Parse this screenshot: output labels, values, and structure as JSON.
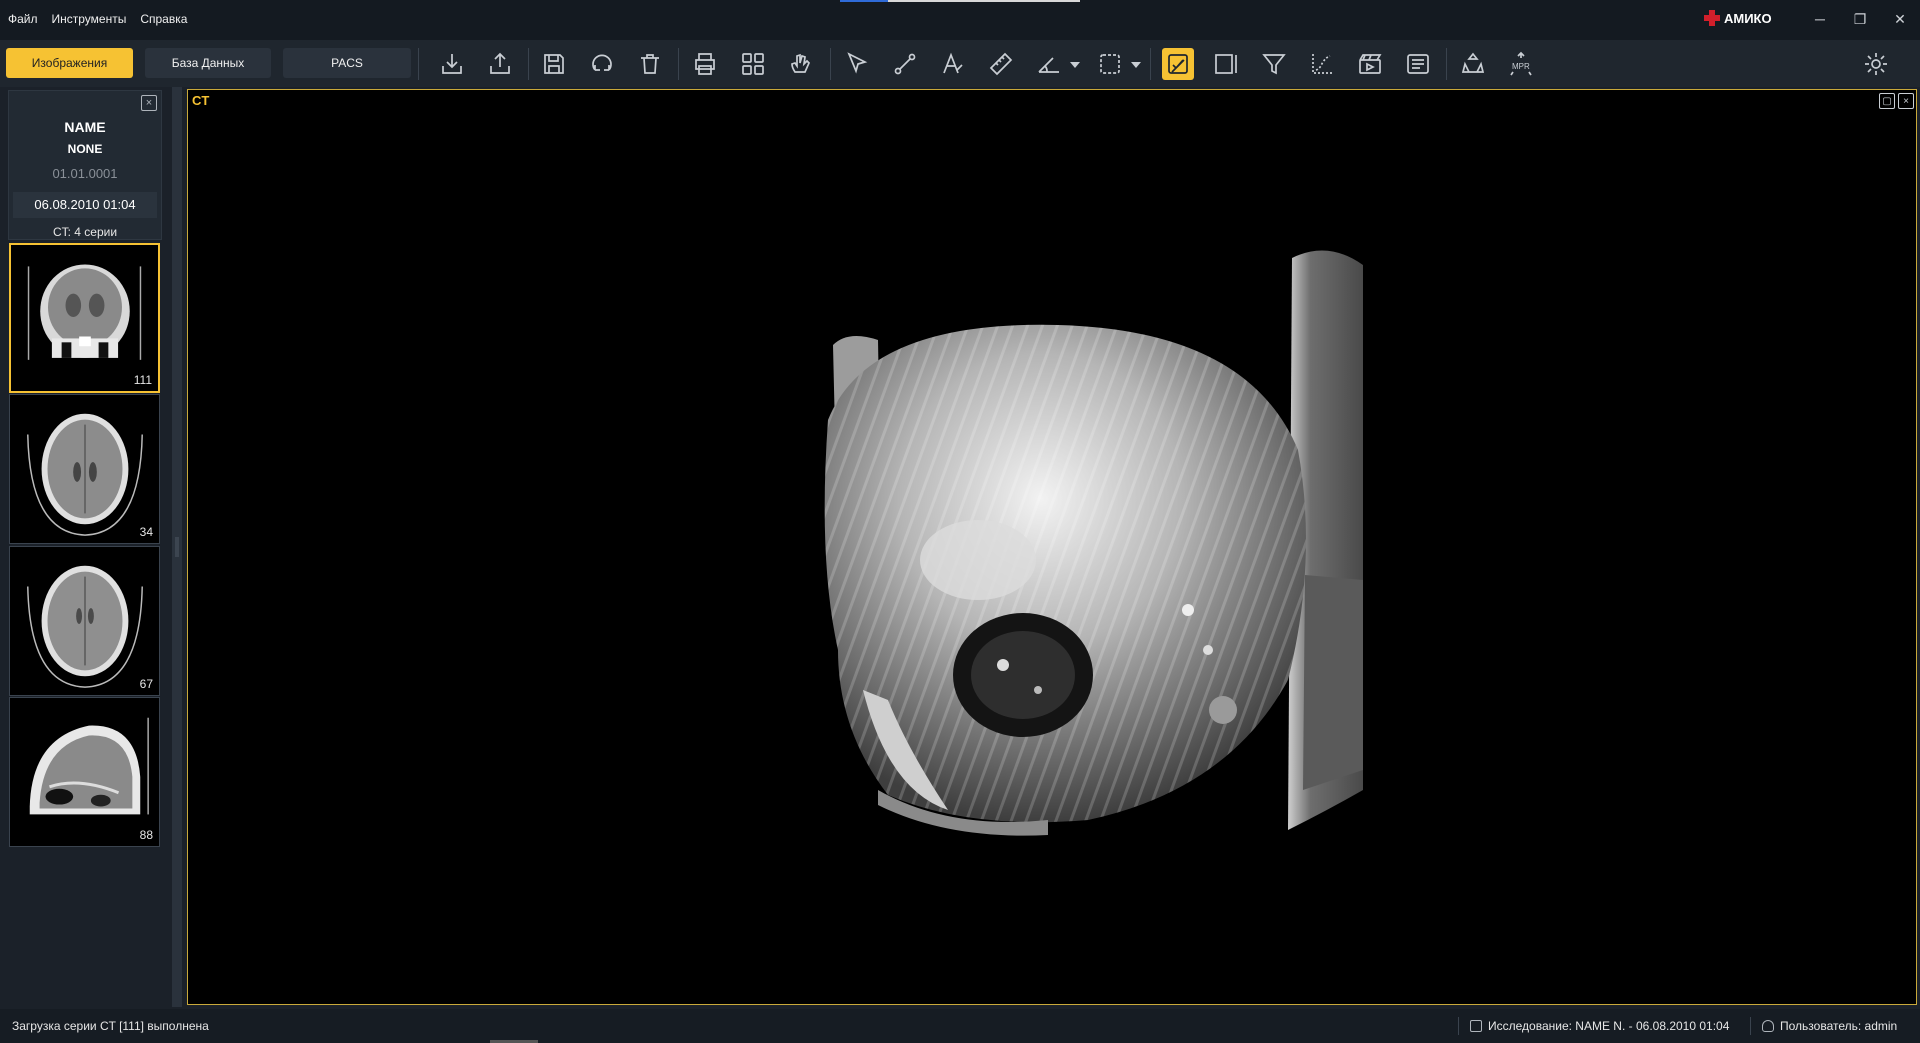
{
  "menu": {
    "file": "Файл",
    "tools": "Инструменты",
    "help": "Справка"
  },
  "brand": {
    "name": "АМИКО",
    "accent_color": "#d21f2b"
  },
  "window_controls": {
    "minimize": "─",
    "restore": "❐",
    "close": "✕"
  },
  "tabs": {
    "images": "Изображения",
    "database": "База Данных",
    "pacs": "PACS"
  },
  "toolbar_icons": [
    "import-icon",
    "export-icon",
    "save-icon",
    "rotate-icon",
    "delete-icon",
    "print-icon",
    "layout-grid-icon",
    "hand-pan-icon",
    "pointer-icon",
    "probe-icon",
    "text-annotation-icon",
    "ruler-icon",
    "angle-icon",
    "roi-select-icon",
    "series-sync-icon",
    "window-frame-icon",
    "filter-icon",
    "curve-icon",
    "cine-icon",
    "report-icon",
    "3d-render-icon",
    "mpr-icon",
    "settings-icon"
  ],
  "toolbar_labels": {
    "mpr": "MPR",
    "three_d": "3D"
  },
  "study": {
    "patient_name": "NAME",
    "patient_id": "NONE",
    "birth_date": "01.01.0001",
    "study_datetime": "06.08.2010 01:04",
    "series_summary": "CT: 4 серии"
  },
  "series_thumbs": [
    {
      "count": "111",
      "view": "coronal"
    },
    {
      "count": "34",
      "view": "axial"
    },
    {
      "count": "67",
      "view": "axial"
    },
    {
      "count": "88",
      "view": "sagittal"
    }
  ],
  "viewport": {
    "modality_label": "CT"
  },
  "status": {
    "message": "Загрузка серии CT [111] выполнена",
    "study_info": "Исследование: NAME N. - 06.08.2010 01:04",
    "user_info": "Пользователь: admin"
  },
  "colors": {
    "accent_yellow": "#f6c233",
    "background": "#1b2129",
    "viewport_border": "#c9a93a"
  }
}
